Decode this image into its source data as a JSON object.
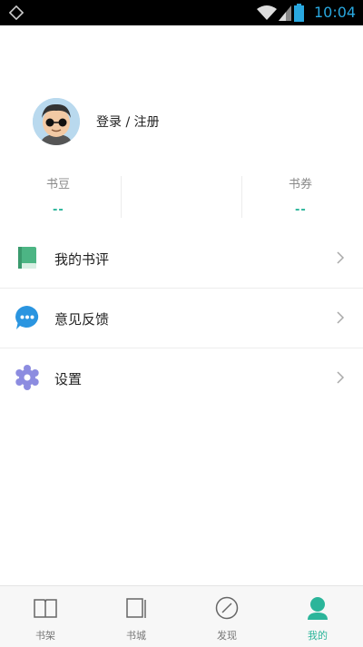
{
  "status_bar": {
    "time": "10:04"
  },
  "profile": {
    "login_text": "登录 / 注册"
  },
  "stats": [
    {
      "label": "书豆",
      "value": "--"
    },
    {
      "label": "书券",
      "value": "--"
    }
  ],
  "menu": [
    {
      "label": "我的书评",
      "icon": "book-icon"
    },
    {
      "label": "意见反馈",
      "icon": "chat-bubble-icon"
    },
    {
      "label": "设置",
      "icon": "gear-icon"
    }
  ],
  "bottom_nav": [
    {
      "label": "书架",
      "icon": "bookshelf-icon",
      "active": false
    },
    {
      "label": "书城",
      "icon": "bookstore-icon",
      "active": false
    },
    {
      "label": "发现",
      "icon": "discover-icon",
      "active": false
    },
    {
      "label": "我的",
      "icon": "profile-icon",
      "active": true
    }
  ],
  "colors": {
    "accent": "#2bb59a",
    "status_bar": "#000000",
    "clock": "#29a8e0"
  }
}
